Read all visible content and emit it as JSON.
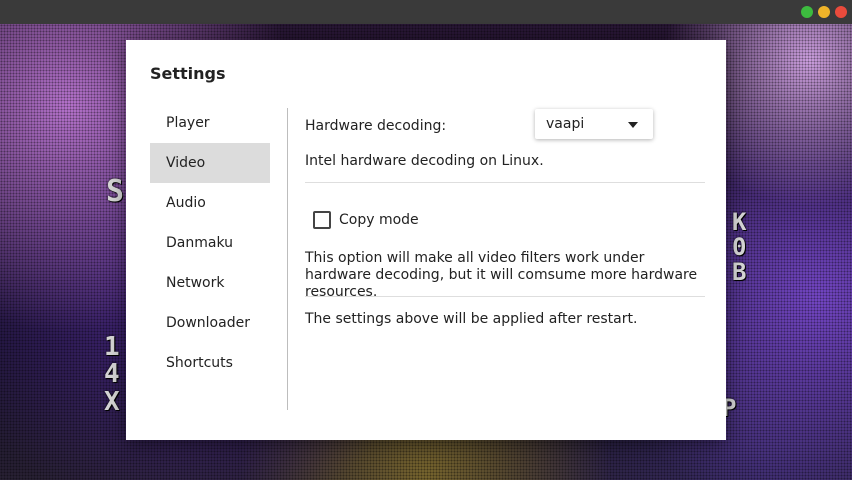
{
  "window": {
    "controls": [
      "minimize",
      "maximize",
      "close"
    ],
    "colors": {
      "minimize": "#3dbb3f",
      "maximize": "#f0b429",
      "close": "#ea4b3c"
    }
  },
  "background_text": {
    "left": "S",
    "left2": "1\n4\nX",
    "right": "K\n0\nB",
    "right2": "P"
  },
  "dialog": {
    "title": "Settings",
    "nav": [
      {
        "label": "Player"
      },
      {
        "label": "Video",
        "active": true
      },
      {
        "label": "Audio"
      },
      {
        "label": "Danmaku"
      },
      {
        "label": "Network"
      },
      {
        "label": "Downloader"
      },
      {
        "label": "Shortcuts"
      }
    ],
    "video": {
      "hw_label": "Hardware decoding:",
      "hw_value": "vaapi",
      "hw_desc": "Intel hardware decoding on Linux.",
      "copy_mode_label": "Copy mode",
      "copy_mode_checked": false,
      "copy_mode_desc": "This option will make all video filters work under hardware decoding, but it will comsume more hardware resources.",
      "restart_note": "The settings above will be applied after restart."
    }
  }
}
